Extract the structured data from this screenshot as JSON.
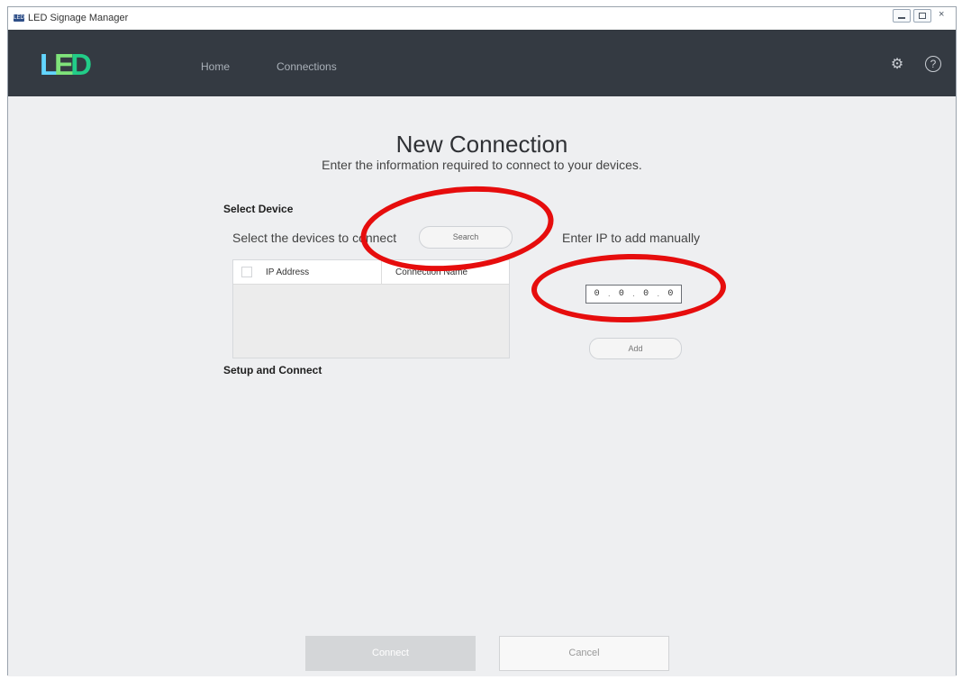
{
  "window": {
    "icon_text": "LED",
    "title": "LED Signage Manager",
    "controls": [
      "minimize",
      "maximize",
      "close"
    ]
  },
  "navbar": {
    "logo": {
      "part1": "L",
      "part2": "E",
      "part3": "D"
    },
    "items": [
      {
        "label": "Home"
      },
      {
        "label": "Connections"
      }
    ],
    "icons": {
      "settings": "gear-icon",
      "help": "help-icon"
    },
    "help_symbol": "?"
  },
  "page": {
    "title": "New Connection",
    "subtitle": "Enter the information required to connect to your devices."
  },
  "select_device": {
    "section_title": "Select Device",
    "hint": "Select the devices to connect",
    "search_button": "Search",
    "manual_hint": "Enter IP to add manually",
    "table": {
      "columns": [
        "IP Address",
        "Connection Name"
      ]
    },
    "ip_input": {
      "octets": [
        "0",
        "0",
        "0",
        "0"
      ]
    },
    "add_button": "Add"
  },
  "setup": {
    "section_title": "Setup and Connect"
  },
  "footer": {
    "connect_button": "Connect",
    "cancel_button": "Cancel"
  },
  "annotations": {
    "highlight_color": "#e60d0d"
  }
}
